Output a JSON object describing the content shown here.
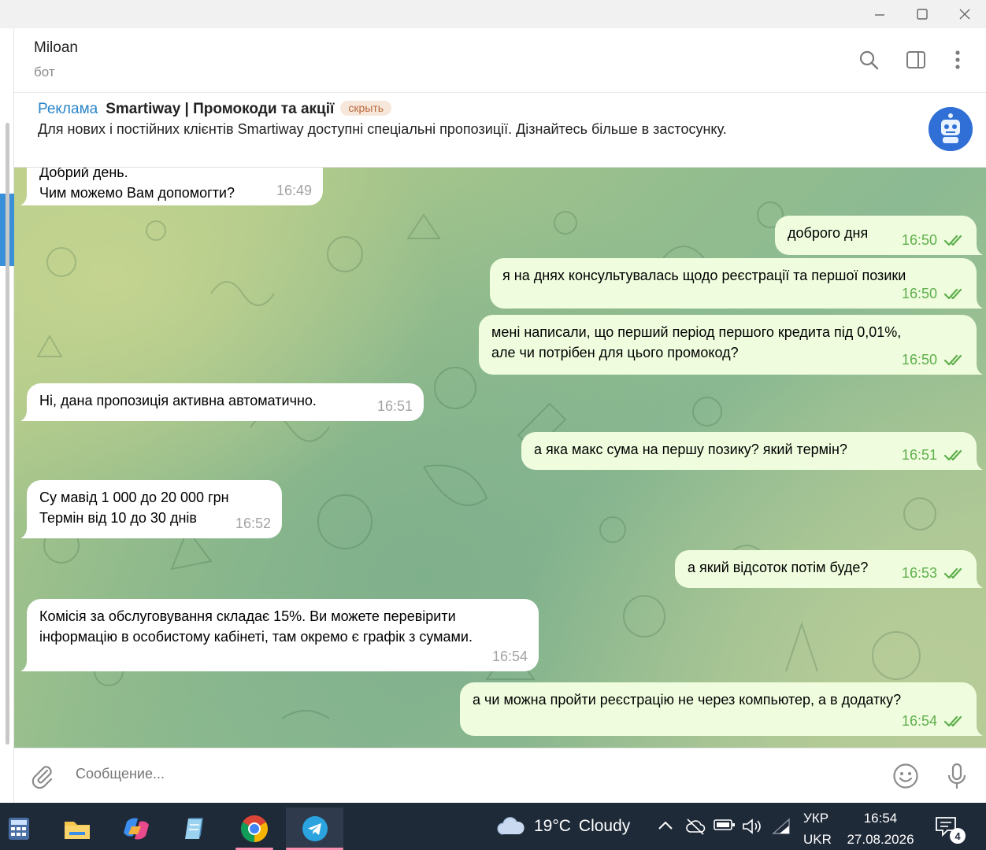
{
  "window": {
    "minimize_icon": "minimize-icon",
    "maximize_icon": "maximize-icon",
    "close_icon": "close-icon"
  },
  "header": {
    "name": "Miloan",
    "status": "бот"
  },
  "ad": {
    "label": "Реклама",
    "title": "Smartiway | Промокоди та акції",
    "hide": "скрыть",
    "text": "Для нових і постійних клієнтів Smartiway доступні спеціальні пропозиції. Дізнайтесь більше в застосунку."
  },
  "messages": [
    {
      "dir": "in",
      "text": "Добрий день.\nЧим можемо Вам допомогти?",
      "time": "16:49"
    },
    {
      "dir": "out",
      "text": "доброго дня",
      "time": "16:50"
    },
    {
      "dir": "out",
      "text": "я на днях консультувалась щодо реєстрації та першої позики",
      "time": "16:50"
    },
    {
      "dir": "out",
      "text": "мені написали, що перший період першого кредита під 0,01%,\nале чи потрібен для цього промокод?",
      "time": "16:50"
    },
    {
      "dir": "in",
      "text": "Ні, дана пропозиція активна автоматично.",
      "time": "16:51"
    },
    {
      "dir": "out",
      "text": "а яка макс сума на першу позику? який термін?",
      "time": "16:51"
    },
    {
      "dir": "in",
      "text": "Су мавід 1 000 до 20 000 грн\nТермін від 10 до 30 днів",
      "time": "16:52"
    },
    {
      "dir": "out",
      "text": "а який відсоток потім буде?",
      "time": "16:53"
    },
    {
      "dir": "in",
      "text": "Комісія за обслуговування складає 15%. Ви можете перевірити\nінформацію в особистому кабінеті, там окремо є графік з сумами.",
      "time": "16:54"
    },
    {
      "dir": "out",
      "text": "а чи можна пройти реєстрацію не через компьютер, а в додатку?",
      "time": "16:54"
    }
  ],
  "composer": {
    "placeholder": "Сообщение..."
  },
  "taskbar": {
    "weather_temp": "19°C",
    "weather_text": "Cloudy",
    "lang_top": "УКР",
    "lang_bottom": "UKR",
    "time": "16:54",
    "date": "27.08.2026",
    "notifications": "4"
  },
  "colors": {
    "accent": "#2a84c9",
    "outgoing_bubble": "#effdde",
    "check_green": "#5eae4b",
    "taskbar": "#1f2a39"
  }
}
